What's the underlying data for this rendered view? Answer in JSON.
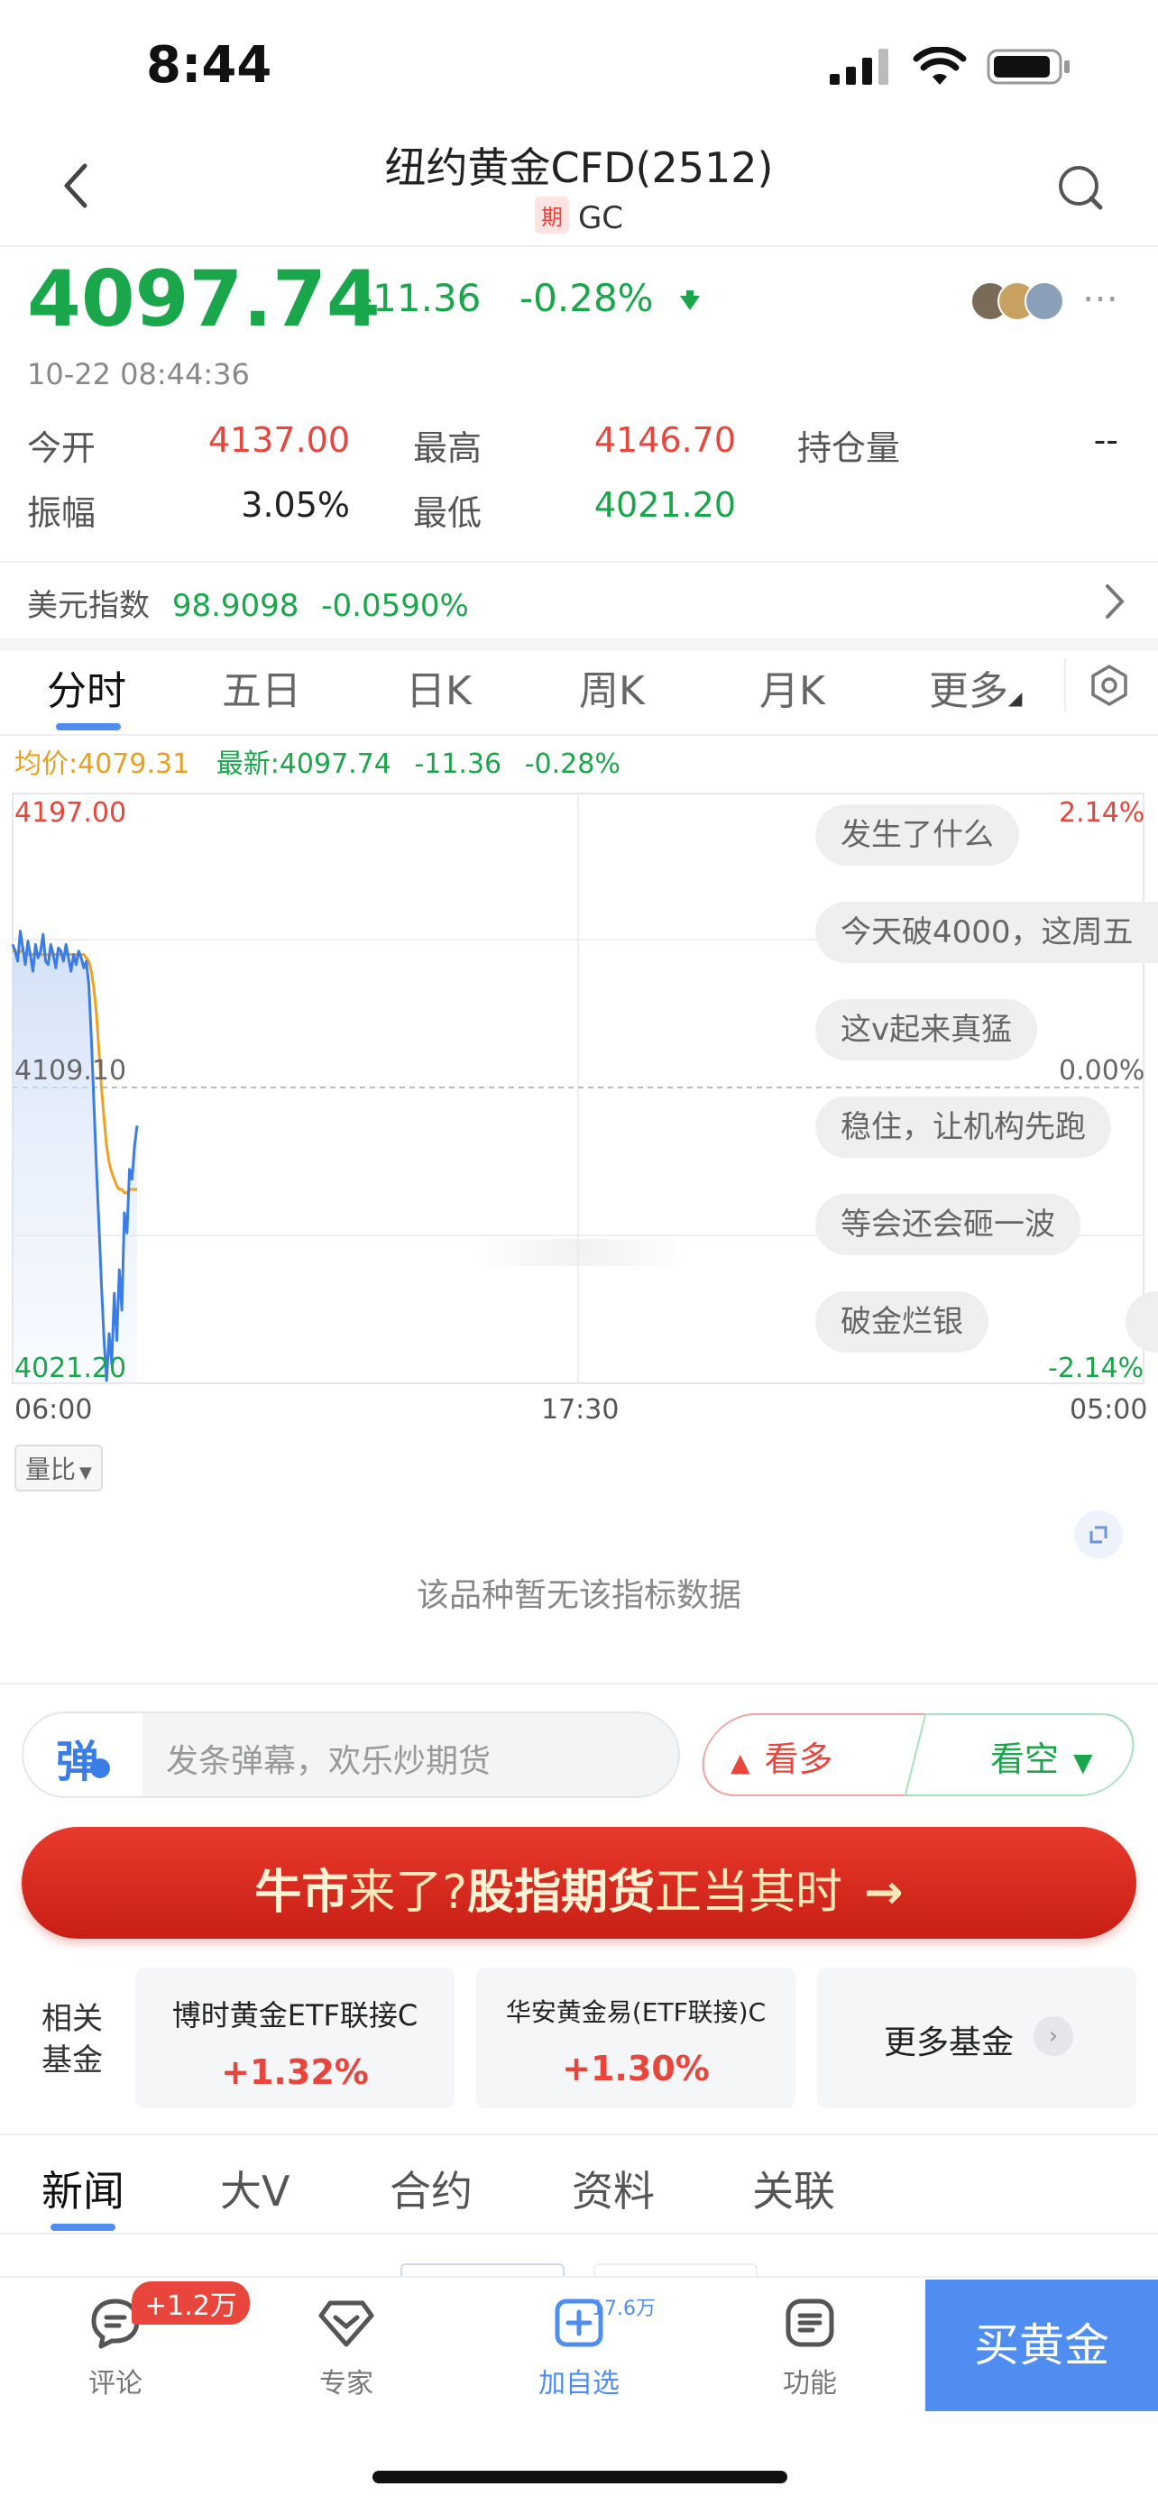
{
  "status": {
    "time": "8:44"
  },
  "header": {
    "title": "纽约黄金CFD(2512)",
    "badge": "期",
    "code": "GC"
  },
  "quote": {
    "price": "4097.74",
    "change": "-11.36",
    "change_pct": "-0.28%",
    "timestamp": "10-22 08:44:36",
    "stats": {
      "open_label": "今开",
      "open": "4137.00",
      "high_label": "最高",
      "high": "4146.70",
      "oi_label": "持仓量",
      "oi": "--",
      "amp_label": "振幅",
      "amp": "3.05%",
      "low_label": "最低",
      "low": "4021.20"
    }
  },
  "dollar_index": {
    "label": "美元指数",
    "value": "98.9098",
    "change": "-0.0590%"
  },
  "chart_tabs": [
    "分时",
    "五日",
    "日K",
    "周K",
    "月K",
    "更多"
  ],
  "chart_legend": {
    "avg": "均价:4079.31",
    "latest": "最新:4097.74",
    "change": "-11.36",
    "pct": "-0.28%"
  },
  "chart_data": {
    "type": "line",
    "x_start": "06:00",
    "x_mid": "17:30",
    "x_end": "05:00",
    "y_top": "4197.00",
    "y_mid": "4109.10",
    "y_bottom": "4021.20",
    "pct_top": "2.14%",
    "pct_mid": "0.00%",
    "pct_bottom": "-2.14%",
    "ylim": [
      4021.2,
      4197.0
    ],
    "series": [
      {
        "name": "最新",
        "values": [
          4152,
          4150,
          4147,
          4156,
          4151,
          4146,
          4153,
          4149,
          4144,
          4152,
          4148,
          4150,
          4155,
          4147,
          4146,
          4152,
          4149,
          4145,
          4151,
          4150,
          4147,
          4152,
          4148,
          4144,
          4149,
          4146,
          4150,
          4148,
          4145,
          4147,
          4140,
          4124,
          4105,
          4085,
          4068,
          4050,
          4034,
          4022,
          4036,
          4027,
          4048,
          4034,
          4055,
          4043,
          4072,
          4066,
          4085,
          4082,
          4092,
          4098
        ]
      },
      {
        "name": "均价",
        "values": [
          4150,
          4150,
          4149,
          4150,
          4150,
          4149,
          4149,
          4149,
          4149,
          4149,
          4149,
          4149,
          4149,
          4149,
          4149,
          4149,
          4149,
          4149,
          4149,
          4149,
          4149,
          4149,
          4149,
          4149,
          4149,
          4149,
          4149,
          4149,
          4149,
          4148,
          4147,
          4144,
          4139,
          4131,
          4120,
          4109,
          4100,
          4092,
          4087,
          4084,
          4082,
          4080,
          4079,
          4079,
          4078,
          4078,
          4079,
          4079,
          4079,
          4079
        ]
      }
    ]
  },
  "danmaku": [
    "发生了什么",
    "今天破4000，这周五",
    "这v起来真猛",
    "稳住，让机构先跑",
    "等会还会砸一波",
    "破金烂银"
  ],
  "indicator": {
    "liangbi": "量比",
    "no_data": "该品种暂无该指标数据"
  },
  "comment_bar": {
    "logo": "弹",
    "placeholder": "发条弹幕，欢乐炒期货",
    "bull": "看多",
    "bear": "看空"
  },
  "banner": {
    "part1": "牛市",
    "part2": "来了?",
    "part3": "股指期货",
    "part4": "正当其时",
    "arrow": "→"
  },
  "funds": {
    "label": "相关\n基金",
    "label1": "相关",
    "label2": "基金",
    "items": [
      {
        "name": "博时黄金ETF联接C",
        "pct": "+1.32%"
      },
      {
        "name": "华安黄金易(ETF联接)C",
        "pct": "+1.30%"
      }
    ],
    "more": "更多基金"
  },
  "news_tabs": [
    "新闻",
    "大V",
    "合约",
    "资料",
    "关联"
  ],
  "bottom_nav": {
    "comment": "评论",
    "comment_badge": "+1.2万",
    "expert": "专家",
    "add": "加自选",
    "add_count": "17.6万",
    "func": "功能",
    "buy": "买黄金"
  },
  "colors": {
    "up": "#e8453c",
    "down": "#1aa64b",
    "accent": "#4f8ef0",
    "avg_line": "#f0a020"
  }
}
